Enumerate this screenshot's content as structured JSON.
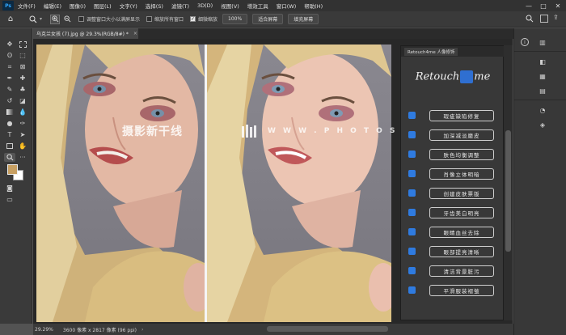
{
  "menubar": {
    "logo": "Ps",
    "items": [
      "文件(F)",
      "编辑(E)",
      "图像(I)",
      "图层(L)",
      "文字(Y)",
      "选择(S)",
      "滤镜(T)",
      "3D(D)",
      "视图(V)",
      "增效工具",
      "窗口(W)",
      "帮助(H)"
    ],
    "window_controls": [
      "—",
      "□",
      "✕"
    ]
  },
  "options": {
    "resize_windows": "调整窗口大小以满屏显示",
    "resize_windows_checked": false,
    "zoom_all": "缩放所有窗口",
    "zoom_all_checked": false,
    "scrubby": "细微缩放",
    "scrubby_checked": true,
    "zoom_level": "100%",
    "fit_screen": "适合屏幕",
    "fill_screen": "填充屏幕"
  },
  "document": {
    "tab_title": "乌克兰女孩 (7).jpg @ 29.3%(RGB/8#) *",
    "tab_close": "×"
  },
  "watermark": {
    "left": "摄影新干线",
    "right": "W W W . P H O T O S K S . V I P"
  },
  "plugin": {
    "tab": "Retouch4me 人像修饰",
    "logo_left": "Retouch",
    "logo_right": "me",
    "buttons": [
      "瑕疵缺陷修复",
      "加深减淡磨皮",
      "肤色均衡调整",
      "肖像立体明暗",
      "创建皮肤票版",
      "牙齿美白明亮",
      "眼睛血丝去除",
      "眼部提亮清晰",
      "清洁背景脏污",
      "平滑服装褶皱"
    ]
  },
  "status": {
    "zoom": "29.29%",
    "doc_info": "3600 像素 x 2817 像素 (96 ppi)",
    "arrow": "›"
  },
  "colors": {
    "accent_blue": "#2f7be0",
    "foreground_swatch": "#c8a062",
    "background_swatch": "#ffffff"
  }
}
